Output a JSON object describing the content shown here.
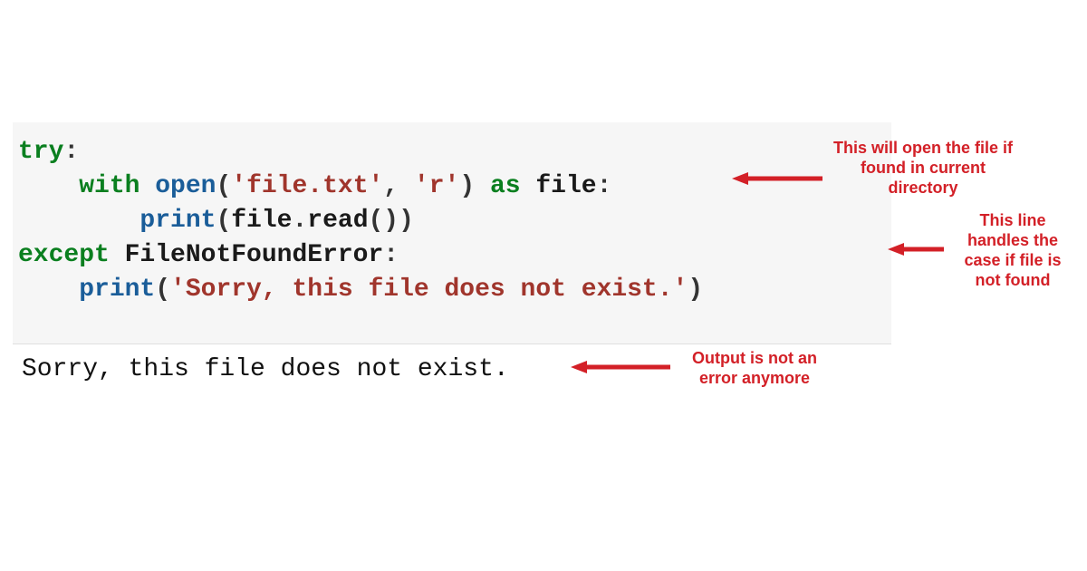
{
  "code": {
    "line1": {
      "kw": "try",
      "colon": ":"
    },
    "line2": {
      "indent": "    ",
      "kw1": "with",
      "fn": " open",
      "p1": "(",
      "s1": "'file.txt'",
      "comma": ", ",
      "s2": "'r'",
      "p2": ") ",
      "kw2": "as",
      "name": " file",
      "colon": ":"
    },
    "line3": {
      "indent": "        ",
      "fn": "print",
      "p1": "(",
      "name1": "file",
      "dot": ".",
      "name2": "read",
      "p2": "())"
    },
    "line4": {
      "kw": "except",
      "name": " FileNotFoundError",
      "colon": ":"
    },
    "line5": {
      "indent": "    ",
      "fn": "print",
      "p1": "(",
      "s": "'Sorry, this file does not exist.'",
      "p2": ")"
    }
  },
  "output": "Sorry, this file does not exist.",
  "annotations": {
    "a1": "This will open the file if found in current directory",
    "a2": "This line handles the case if file is not found",
    "a3": "Output is not an error anymore"
  },
  "colors": {
    "annotation": "#d32027",
    "code_bg": "#f6f6f6"
  }
}
